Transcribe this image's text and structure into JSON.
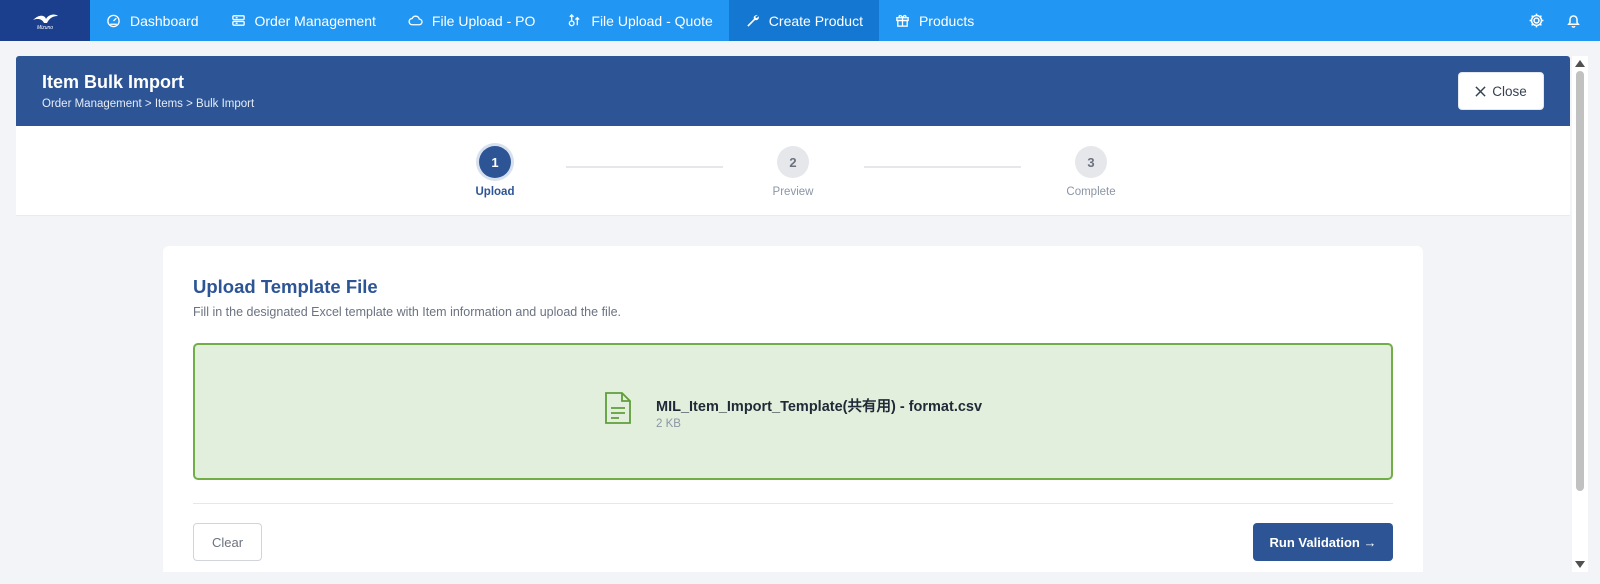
{
  "nav": {
    "logo": "Mizuno",
    "items": [
      {
        "label": "Dashboard",
        "icon": "gauge-icon"
      },
      {
        "label": "Order Management",
        "icon": "order-icon"
      },
      {
        "label": "File Upload - PO",
        "icon": "cloud-icon"
      },
      {
        "label": "File Upload - Quote",
        "icon": "upload-quote-icon"
      },
      {
        "label": "Create Product",
        "icon": "wrench-icon",
        "active": true
      },
      {
        "label": "Products",
        "icon": "gift-icon"
      }
    ],
    "right_icons": [
      "gear-icon",
      "bell-icon"
    ]
  },
  "header": {
    "title": "Item Bulk Import",
    "breadcrumb": "Order Management > Items > Bulk Import",
    "close_label": "Close"
  },
  "stepper": {
    "steps": [
      {
        "number": "1",
        "label": "Upload",
        "state": "active"
      },
      {
        "number": "2",
        "label": "Preview",
        "state": "pending"
      },
      {
        "number": "3",
        "label": "Complete",
        "state": "pending"
      }
    ]
  },
  "upload": {
    "title": "Upload Template File",
    "description": "Fill in the designated Excel template with Item information and upload the file.",
    "file_name": "MIL_Item_Import_Template(共有用) - format.csv",
    "file_size": "2 KB",
    "clear_label": "Clear",
    "run_label": "Run Validation →"
  },
  "colors": {
    "nav_bg": "#2196f3",
    "nav_active": "#1478d2",
    "brand_dark": "#2d5596",
    "dropzone_bg": "#e2efdc",
    "dropzone_border": "#72ae48"
  }
}
